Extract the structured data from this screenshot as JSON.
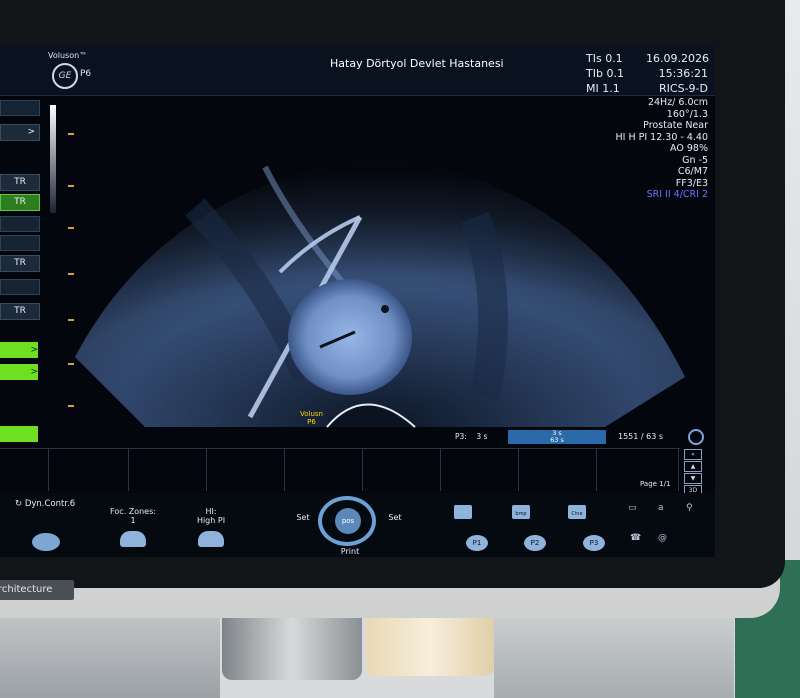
{
  "topbar": {
    "brand": "Voluson™",
    "logo": "GE",
    "model": "P6",
    "hospital": "Hatay Dörtyol Devlet Hastanesi",
    "params": [
      "TIs 0.1",
      "TIb 0.1",
      "MI 1.1"
    ],
    "date": "16.09.2026",
    "time": "15:36:21",
    "probe": "RICS-9-D"
  },
  "right_info": {
    "lines": [
      "24Hz/ 6.0cm",
      "160°/1.3",
      "Prostate Near",
      "HI H PI 12.30 - 4.40",
      "AO 98%",
      "Gn -5",
      "C6/M7",
      "FF3/E3"
    ],
    "highlight": "SRI II 4/CRI 2"
  },
  "left_panel": {
    "tr_labels": [
      "TR",
      "TR",
      "TR",
      "TR"
    ],
    "arrows": [
      ">",
      ">",
      ">"
    ]
  },
  "probe_label": "Volusn\nP6",
  "status": {
    "p_label": "P3:",
    "p_value": "3 s",
    "cine_top": "3 s",
    "cine_bottom": "63 s",
    "count": "1551 / 63 s",
    "page": "Page 1/1"
  },
  "controls": {
    "dyn_contr": "Dyn.Contr.6",
    "foc_zones_label": "Foc. Zones:",
    "foc_zones_value": "1",
    "hi_label": "HI:",
    "hi_value": "High PI",
    "set_left": "Set",
    "set_right": "Set",
    "pos": "pos",
    "print": "Print",
    "p1": "P1",
    "p2": "P2",
    "p3": "P3",
    "save_labels": [
      "",
      "bmp",
      "Cine"
    ]
  },
  "brand_strip": "rchitecture",
  "colors": {
    "accent_blue": "#6da0d4",
    "tr_green": "#2e7d1e",
    "status_green": "#6fe021",
    "probe_yellow": "#ffd400",
    "highlight_purple": "#6a73ff"
  }
}
